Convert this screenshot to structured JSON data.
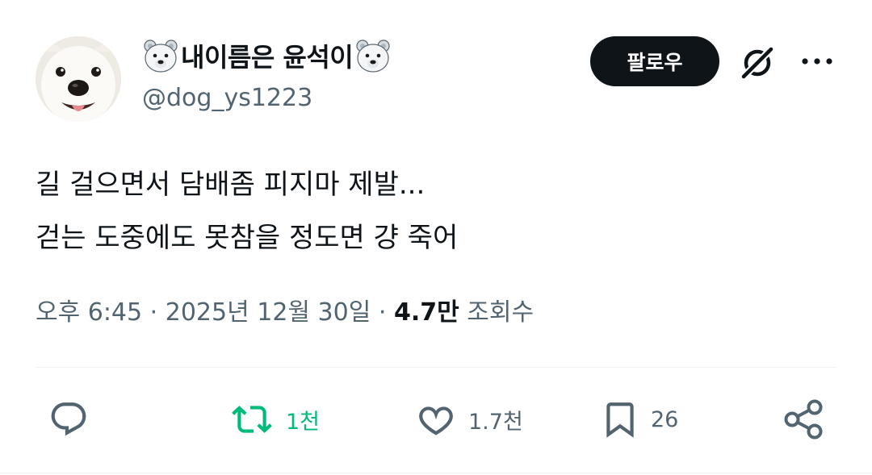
{
  "user": {
    "display_name": "내이름은 윤석이",
    "handle": "@dog_ys1223",
    "name_emoji": "polar-bear-emoji"
  },
  "header": {
    "follow_label": "팔로우"
  },
  "tweet": {
    "lines": [
      "길 걸으면서 담배좀 피지마 제발...",
      "걷는 도중에도 못참을 정도면 걍 죽어"
    ]
  },
  "meta": {
    "time": "오후 6:45",
    "separator": "·",
    "date": "2025년 12월 30일",
    "views_count": "4.7만",
    "views_label": "조회수"
  },
  "actions": {
    "retweets": "1천",
    "likes": "1.7천",
    "bookmarks": "26"
  },
  "colors": {
    "text": "#0f1419",
    "secondary": "#536471",
    "retweet_active": "#00ba7c",
    "divider": "#eff3f4"
  }
}
